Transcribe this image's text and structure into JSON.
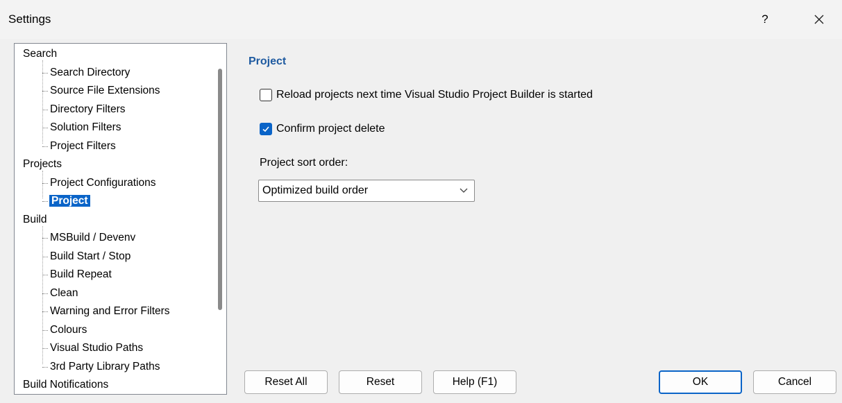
{
  "window": {
    "title": "Settings",
    "help_label": "?"
  },
  "tree": {
    "groups": [
      {
        "label": "Search",
        "children": [
          "Search Directory",
          "Source File Extensions",
          "Directory Filters",
          "Solution Filters",
          "Project Filters"
        ]
      },
      {
        "label": "Projects",
        "children": [
          "Project Configurations",
          "Project"
        ]
      },
      {
        "label": "Build",
        "children": [
          "MSBuild / Devenv",
          "Build Start / Stop",
          "Build Repeat",
          "Clean",
          "Warning and Error Filters",
          "Colours",
          "Visual Studio Paths",
          "3rd Party Library Paths"
        ]
      },
      {
        "label": "Build Notifications",
        "children": []
      }
    ],
    "selected": "Project"
  },
  "panel": {
    "title": "Project",
    "reload_label": "Reload projects next time Visual Studio Project Builder is started",
    "reload_checked": false,
    "confirm_label": "Confirm project delete",
    "confirm_checked": true,
    "sort_label": "Project sort order:",
    "sort_value": "Optimized build order"
  },
  "buttons": {
    "reset_all": "Reset All",
    "reset": "Reset",
    "help": "Help (F1)",
    "ok": "OK",
    "cancel": "Cancel"
  },
  "colors": {
    "accent": "#0a64c8",
    "section_title": "#1e5aa0"
  }
}
